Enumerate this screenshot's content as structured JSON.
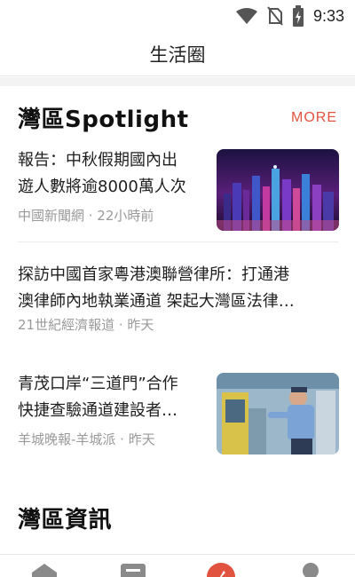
{
  "status_bar": {
    "time": "9:33",
    "icons": [
      "wifi-icon",
      "no-sim-icon",
      "battery-charging-icon"
    ]
  },
  "app_bar": {
    "title": "生活圈"
  },
  "spotlight": {
    "title": "灣區Spotlight",
    "more_label": "MORE",
    "items": [
      {
        "title_line1": "報告：中秋假期國內出",
        "title_line2": "遊人數將逾8000萬人次",
        "source": "中國新聞網 · 22小時前",
        "thumbnail": "city-night-skyline-photo"
      },
      {
        "title_line1": "探訪中國首家粵港澳聯營律所：打通港",
        "title_line2": "澳律師內地執業通道 架起大灣區法律…",
        "source": "21世紀經濟報道 · 昨天"
      },
      {
        "title_line1": "青茂口岸“三道門”合作",
        "title_line2": "快捷查驗通道建設者…",
        "source": "羊城晚報-羊城派 · 昨天",
        "thumbnail": "officer-inspecting-equipment-photo"
      }
    ]
  },
  "news": {
    "title": "灣區資訊"
  },
  "bottom_nav": {
    "tabs": [
      "home-icon",
      "list-icon",
      "compass-icon",
      "profile-icon"
    ],
    "accent": "#e2533f"
  }
}
